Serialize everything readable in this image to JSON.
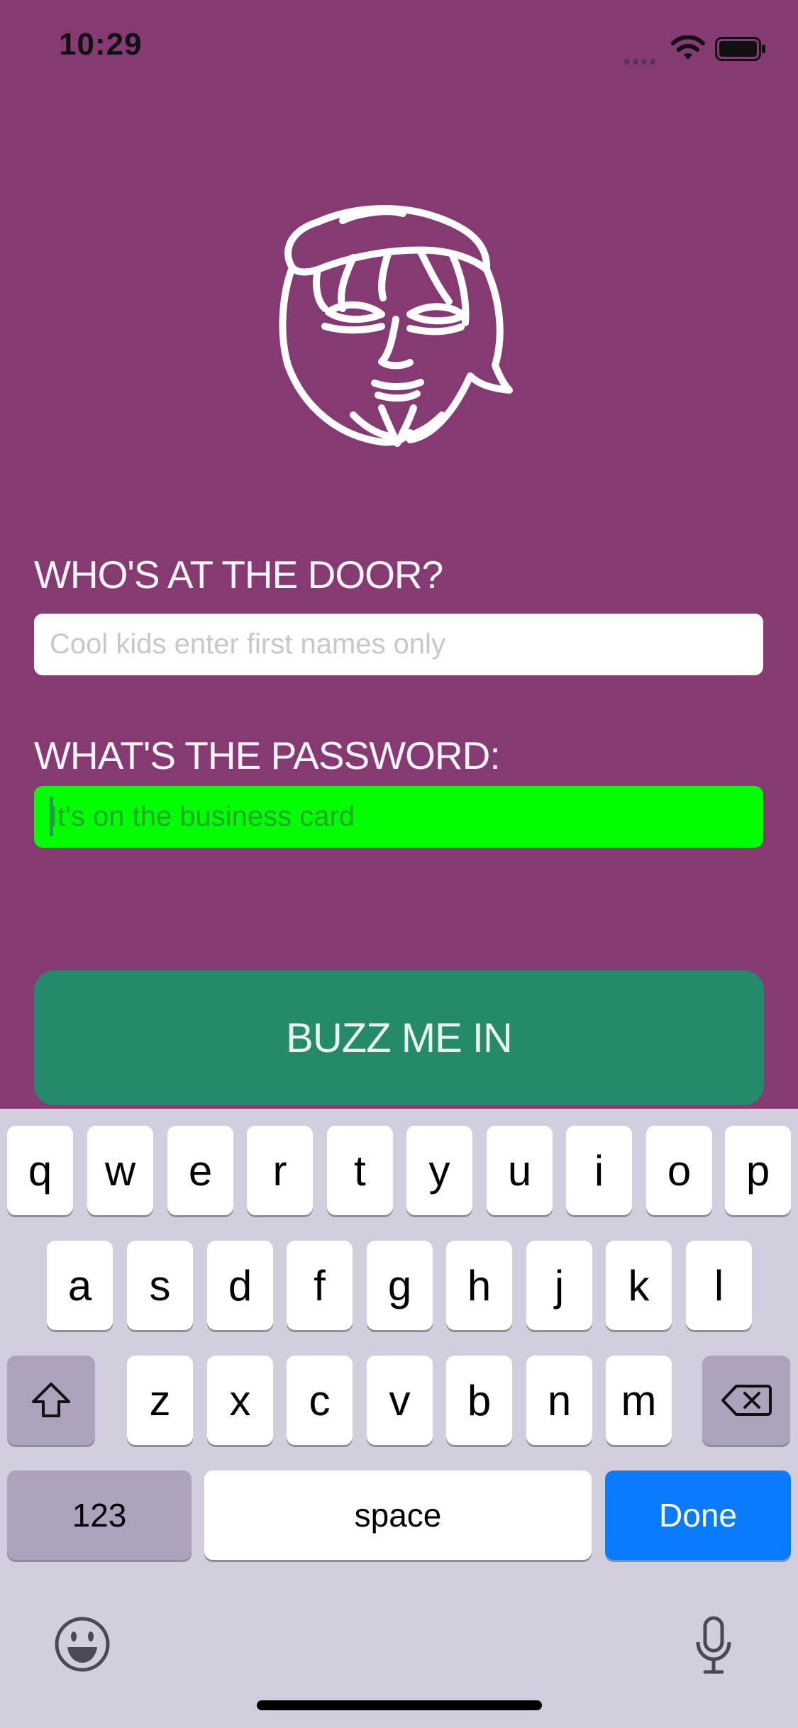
{
  "status_bar": {
    "time": "10:29"
  },
  "form": {
    "name_label": "WHO'S AT THE DOOR?",
    "name_placeholder": "Cool kids enter first names only",
    "password_label": "WHAT'S THE PASSWORD:",
    "password_placeholder": "It's on the business card",
    "submit_label": "BUZZ ME IN"
  },
  "colors": {
    "background": "#863A72",
    "password_field": "#00FF00",
    "button": "#248A69",
    "done_key": "#0A7AFF"
  },
  "keyboard": {
    "row1": [
      "q",
      "w",
      "e",
      "r",
      "t",
      "y",
      "u",
      "i",
      "o",
      "p"
    ],
    "row2": [
      "a",
      "s",
      "d",
      "f",
      "g",
      "h",
      "j",
      "k",
      "l"
    ],
    "row3": [
      "z",
      "x",
      "c",
      "v",
      "b",
      "n",
      "m"
    ],
    "numbers_key": "123",
    "space_key": "space",
    "done_key": "Done"
  }
}
